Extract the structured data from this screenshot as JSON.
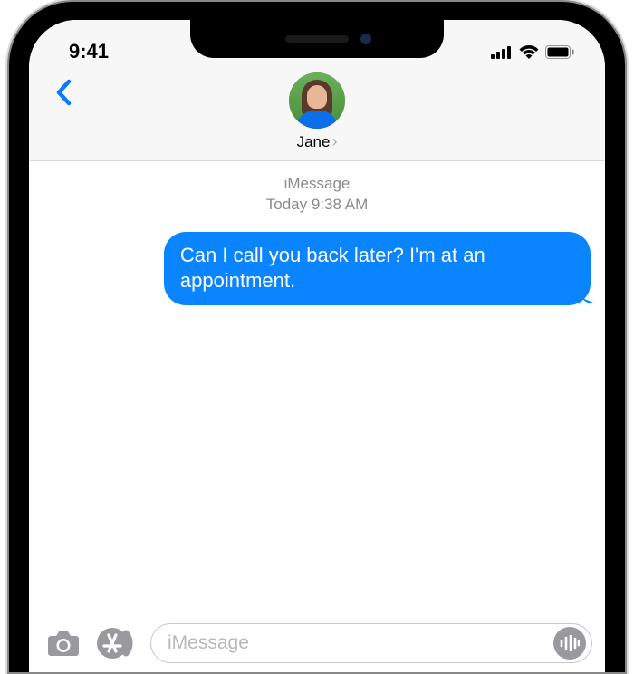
{
  "status": {
    "time": "9:41"
  },
  "header": {
    "contact_name": "Jane"
  },
  "conversation": {
    "service_label": "iMessage",
    "timestamp_label": "Today 9:38 AM",
    "messages": [
      {
        "direction": "sent",
        "text": "Can I call you back later? I'm at an appointment."
      }
    ]
  },
  "compose": {
    "placeholder": "iMessage"
  }
}
